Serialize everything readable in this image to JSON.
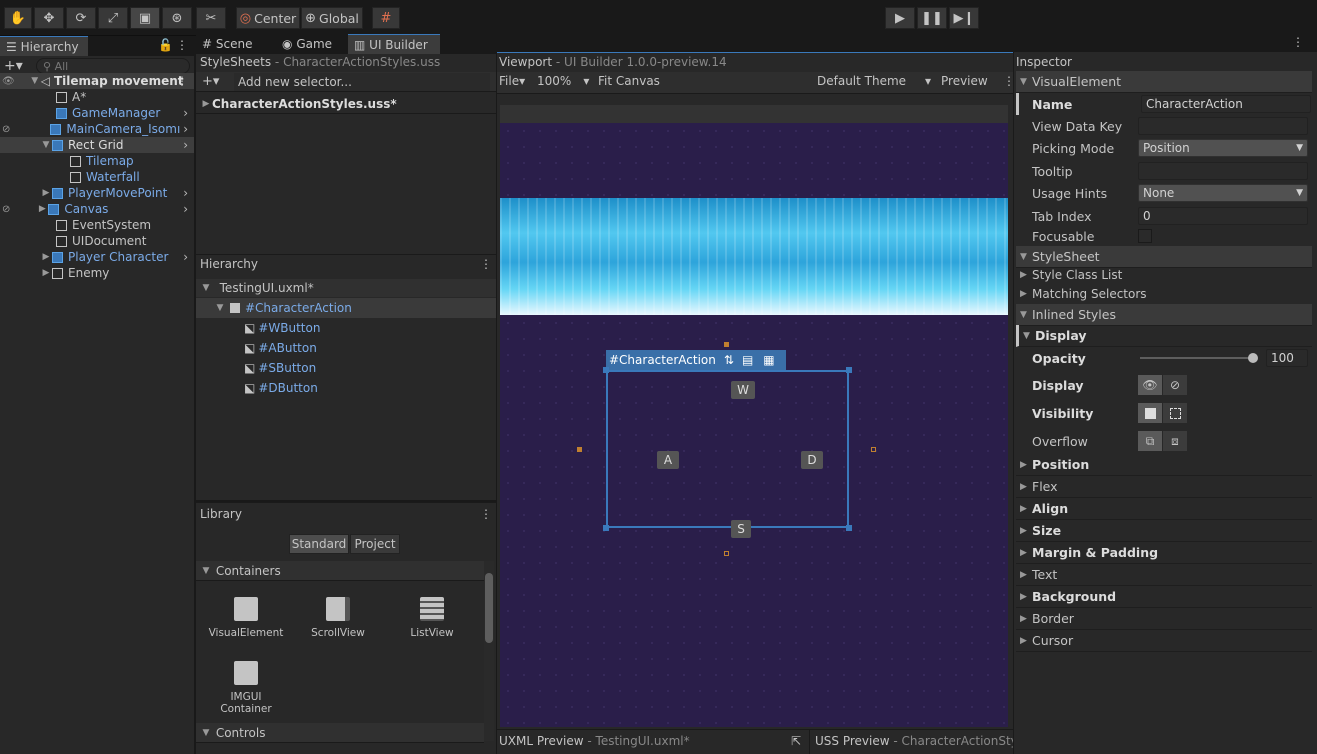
{
  "toolbar": {
    "pivot_label": "Center",
    "space_label": "Global"
  },
  "hierarchy": {
    "tab_label": "Hierarchy",
    "search_placeholder": "All",
    "scene_name": "Tilemap movement",
    "items": [
      {
        "label": "A*"
      },
      {
        "label": "GameManager"
      },
      {
        "label": "MainCamera_Isomı"
      },
      {
        "label": "Rect Grid"
      },
      {
        "label": "Tilemap"
      },
      {
        "label": "Waterfall"
      },
      {
        "label": "PlayerMovePoint"
      },
      {
        "label": "Canvas"
      },
      {
        "label": "EventSystem"
      },
      {
        "label": "UIDocument"
      },
      {
        "label": "Player Character"
      },
      {
        "label": "Enemy"
      }
    ]
  },
  "tabs": {
    "scene": "Scene",
    "game": "Game",
    "uibuilder": "UI Builder"
  },
  "stylesheets": {
    "title": "StyleSheets",
    "subtitle": "- CharacterActionStyles.uss",
    "selector_placeholder": "Add new selector...",
    "file": "CharacterActionStyles.uss*"
  },
  "uxml_hierarchy": {
    "title": "Hierarchy",
    "root": "TestingUI.uxml*",
    "items": [
      "#CharacterAction",
      "#WButton",
      "#AButton",
      "#SButton",
      "#DButton"
    ]
  },
  "library": {
    "title": "Library",
    "tab_standard": "Standard",
    "tab_project": "Project",
    "containers_label": "Containers",
    "items": [
      "VisualElement",
      "ScrollView",
      "ListView",
      "IMGUI Container"
    ],
    "controls_label": "Controls"
  },
  "viewport": {
    "title": "Viewport",
    "subtitle": "- UI Builder 1.0.0-preview.14",
    "file_menu": "File",
    "zoom": "100%",
    "fit_canvas": "Fit Canvas",
    "theme": "Default Theme",
    "preview": "Preview",
    "element_name": "#CharacterAction",
    "buttons": {
      "w": "W",
      "a": "A",
      "s": "S",
      "d": "D"
    },
    "uxml_preview": "UXML Preview",
    "uxml_file": "- TestingUI.uxml*",
    "uss_preview": "USS Preview",
    "uss_file": "- CharacterActionSty"
  },
  "inspector": {
    "title": "Inspector",
    "section_visual": "VisualElement",
    "name_label": "Name",
    "name_value": "CharacterAction",
    "view_data_key_label": "View Data Key",
    "picking_mode_label": "Picking Mode",
    "picking_mode_value": "Position",
    "tooltip_label": "Tooltip",
    "usage_hints_label": "Usage Hints",
    "usage_hints_value": "None",
    "tab_index_label": "Tab Index",
    "tab_index_value": "0",
    "focusable_label": "Focusable",
    "section_stylesheet": "StyleSheet",
    "style_class_list": "Style Class List",
    "matching_selectors": "Matching Selectors",
    "section_inlined": "Inlined Styles",
    "display_group": "Display",
    "opacity_label": "Opacity",
    "opacity_value": "100",
    "display_label": "Display",
    "visibility_label": "Visibility",
    "overflow_label": "Overflow",
    "folds": [
      "Position",
      "Flex",
      "Align",
      "Size",
      "Margin & Padding",
      "Text",
      "Background",
      "Border",
      "Cursor"
    ]
  }
}
